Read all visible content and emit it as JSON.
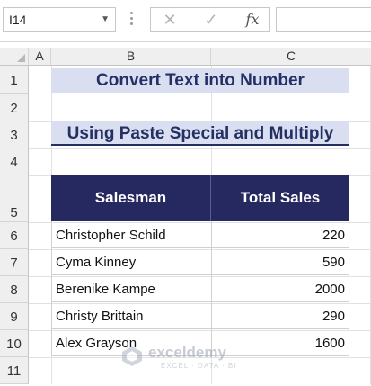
{
  "formula_bar": {
    "name_box": "I14",
    "cancel_icon": "✕",
    "enter_icon": "✓",
    "fx_label": "fx",
    "formula": ""
  },
  "columns": [
    "A",
    "B",
    "C"
  ],
  "rows": [
    "1",
    "2",
    "3",
    "4",
    "5",
    "6",
    "7",
    "8",
    "9",
    "10",
    "11"
  ],
  "sheet": {
    "title1": "Convert Text into Number",
    "title2": "Using Paste Special and Multiply",
    "table": {
      "headers": [
        "Salesman",
        "Total Sales"
      ],
      "rows": [
        {
          "name": "Christopher Schild",
          "sales": "220"
        },
        {
          "name": "Cyma Kinney",
          "sales": "590"
        },
        {
          "name": "Berenike Kampe",
          "sales": "2000"
        },
        {
          "name": "Christy Brittain",
          "sales": "290"
        },
        {
          "name": "Alex Grayson",
          "sales": "1600"
        }
      ]
    }
  },
  "watermark": {
    "name": "exceldemy",
    "tagline": "EXCEL · DATA · BI"
  },
  "colors": {
    "title_fill": "#d9dff0",
    "title_text": "#243064",
    "header_fill": "#26295f"
  }
}
